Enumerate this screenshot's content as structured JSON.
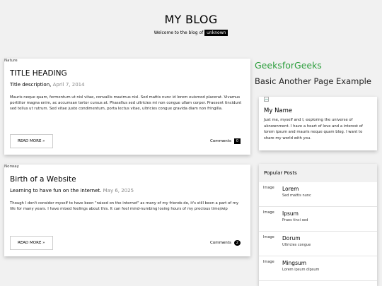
{
  "header": {
    "title": "MY BLOG",
    "welcome": "Welcome to the blog of ",
    "name": "unknown"
  },
  "posts": [
    {
      "image_alt": "Nature",
      "title": "TITLE HEADING",
      "description": "Title description,",
      "date": "April 7, 2014",
      "body": "Mauris neque quam, fermentum ut nisl vitae, convallis maximus nisl. Sed mattis nunc id lorem euismod placerat. Vivamus porttitor magna enim, ac accumsan tortor cursus at. Phasellus sed ultricies mi non congue ullam corper. Praesent tincidunt sed tellus ut rutrum. Sed vitae justo condimentum, porta lectus vitae, ultricies congue gravida diam non fringilla.",
      "read_more": "READ MORE »",
      "comments_label": "Comments",
      "comments_count": "0"
    },
    {
      "image_alt": "Norway",
      "title": "Birth of a Website",
      "description": "Learning to have fun on the internet.",
      "date": "May 6, 2025",
      "body": "Though I don't consider myself to have been \"raised on the internet\" as many of my friends do, it's still been a part of my life for many years. I have mixed feelings about this. It can feel mind-numbing losing hours of my precious time/wip",
      "read_more": "READ MORE »",
      "comments_label": "Comments",
      "comments_count": "2"
    }
  ],
  "sidebar": {
    "brand": "GeeksforGeeks",
    "subtitle": "Basic Another Page Example",
    "about": {
      "image_icon": "broken-image-icon",
      "title": "My Name",
      "text": "Just me, myself and I, exploring the universe of uknownment. I have a heart of love and a interest of lorem ipsum and mauris neque quam blog. I want to share my world with you."
    },
    "popular": {
      "heading": "Popular Posts",
      "items": [
        {
          "thumb": "Image",
          "title": "Lorem",
          "subtitle": "Sed mattis nunc"
        },
        {
          "thumb": "Image",
          "title": "Ipsum",
          "subtitle": "Praes tinci sed"
        },
        {
          "thumb": "Image",
          "title": "Dorum",
          "subtitle": "Ultricies congue"
        },
        {
          "thumb": "Image",
          "title": "Mingsum",
          "subtitle": "Lorem ipsum dipsum"
        }
      ]
    }
  },
  "colors": {
    "brand": "#2d9e3d",
    "background": "#f1f1f1"
  }
}
